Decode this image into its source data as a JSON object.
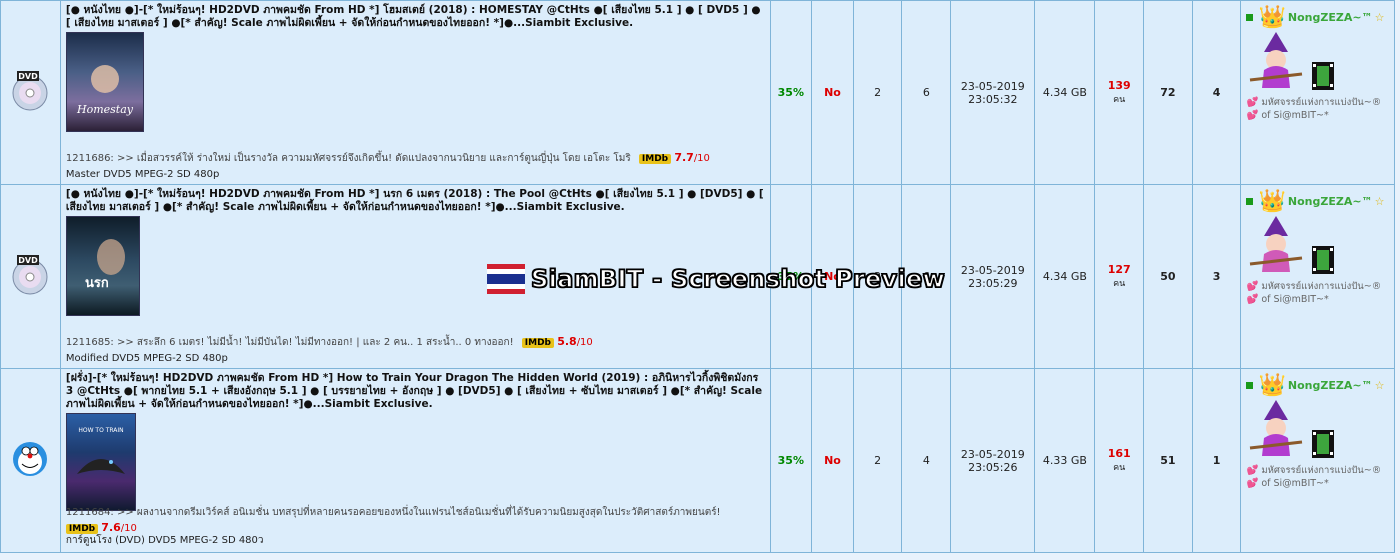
{
  "torrents": [
    {
      "title": "[● หนังไทย ●]-[* ใหม่ร้อนๆ! HD2DVD ภาพคมชัด From HD *] โฮมสเตย์ (2018) : HOMESTAY @CtHts ●[ เสียงไทย 5.1 ] ● [ DVD5 ] ● [ เสียงไทย มาสเตอร์ ] ●[* สำคัญ! Scale ภาพไม่ผิดเพี้ยน + จัดให้ก่อนกำหนดของไทยออก! *]●...Siambit Exclusive.",
      "desc": "1211686: >> เมื่อสวรรค์ให้ ร่างใหม่ เป็นรางวัล ความมหัศจรรย์จึงเกิดขึ้น! ดัดแปลงจากนวนิยาย และการ์ตูนญี่ปุ่น โดย เอโตะ โมริ",
      "imdb_label": "IMDb",
      "imdb_score": "7.7",
      "imdb_max": "/10",
      "tags": "Master    DVD5   MPEG-2   SD 480p",
      "percent": "35%",
      "free": "No",
      "col3": "2",
      "col4": "6",
      "date": "23-05-2019",
      "time": "23:05:32",
      "size": "4.34 GB",
      "snatched": "139",
      "unit": "คน",
      "seeders": "72",
      "leechers": "4",
      "uploader": "NongZEZA~™",
      "sig": "💕 มหัศจรรย์แห่งการแบ่งปัน~® 💕 of Si@mBIT~*",
      "category_icon": "dvd-disc-icon"
    },
    {
      "title": "[● หนังไทย ●]-[* ใหม่ร้อนๆ! HD2DVD ภาพคมชัด From HD *] นรก 6 เมตร (2018) : The Pool @CtHts ●[ เสียงไทย 5.1 ] ● [DVD5] ● [ เสียงไทย มาสเตอร์ ] ●[* สำคัญ! Scale ภาพไม่ผิดเพี้ยน + จัดให้ก่อนกำหนดของไทยออก! *]●...Siambit Exclusive.",
      "desc": "1211685: >> สระลึก 6 เมตร! ไม่มีน้ำ! ไม่มีบันได! ไม่มีทางออก! | และ 2 คน.. 1 สระน้ำ.. 0 ทางออก!",
      "imdb_label": "IMDb",
      "imdb_score": "5.8",
      "imdb_max": "/10",
      "tags": "Modified    DVD5   MPEG-2   SD 480p",
      "percent": "35%",
      "free": "No",
      "col3": "2",
      "col4": "6",
      "date": "23-05-2019",
      "time": "23:05:29",
      "size": "4.34 GB",
      "snatched": "127",
      "unit": "คน",
      "seeders": "50",
      "leechers": "3",
      "uploader": "NongZEZA~™",
      "sig": "💕 มหัศจรรย์แห่งการแบ่งปัน~® 💕 of Si@mBIT~*",
      "category_icon": "dvd-disc-icon"
    },
    {
      "title": "[ฝรั่ง]-[* ใหม่ร้อนๆ! HD2DVD ภาพคมชัด From HD *] How to Train Your Dragon The Hidden World (2019) : อภินิหารไวกิ้งพิชิตมังกร 3 @CtHts ●[ พากยไทย 5.1 + เสียงอังกฤษ 5.1 ] ● [ บรรยายไทย + อังกฤษ ] ● [DVD5] ● [ เสียงไทย + ซับไทย มาสเตอร์ ] ●[* สำคัญ! Scale ภาพไม่ผิดเพี้ยน + จัดให้ก่อนกำหนดของไทยออก! *]●...Siambit Exclusive.",
      "desc": "1211684: >> ผลงานจากดรีมเวิร์คส์ อนิเมชั่น บทสรุปที่หลายคนรอคอยของหนึ่งในแฟรนไชส์อนิเมชั่นที่ได้รับความนิยมสูงสุดในประวัติศาสตร์ภาพยนตร์!",
      "imdb_label": "IMDb",
      "imdb_score": "7.6",
      "imdb_max": "/10",
      "tags": "การ์ตูนโรง (DVD)    DVD5   MPEG-2   SD 480ว",
      "percent": "35%",
      "free": "No",
      "col3": "2",
      "col4": "4",
      "date": "23-05-2019",
      "time": "23:05:26",
      "size": "4.33 GB",
      "snatched": "161",
      "unit": "คน",
      "seeders": "51",
      "leechers": "1",
      "uploader": "NongZEZA~™",
      "sig": "💕 มหัศจรรย์แห่งการแบ่งปัน~® 💕 of Si@mBIT~*",
      "category_icon": "doraemon-cartoon-icon"
    }
  ],
  "watermark": "SiamBIT - Screenshot Preview",
  "colors": {
    "accent": "#d00000",
    "green": "#008800",
    "row_bg": "#dcedfb",
    "border": "#7fb4d8"
  }
}
